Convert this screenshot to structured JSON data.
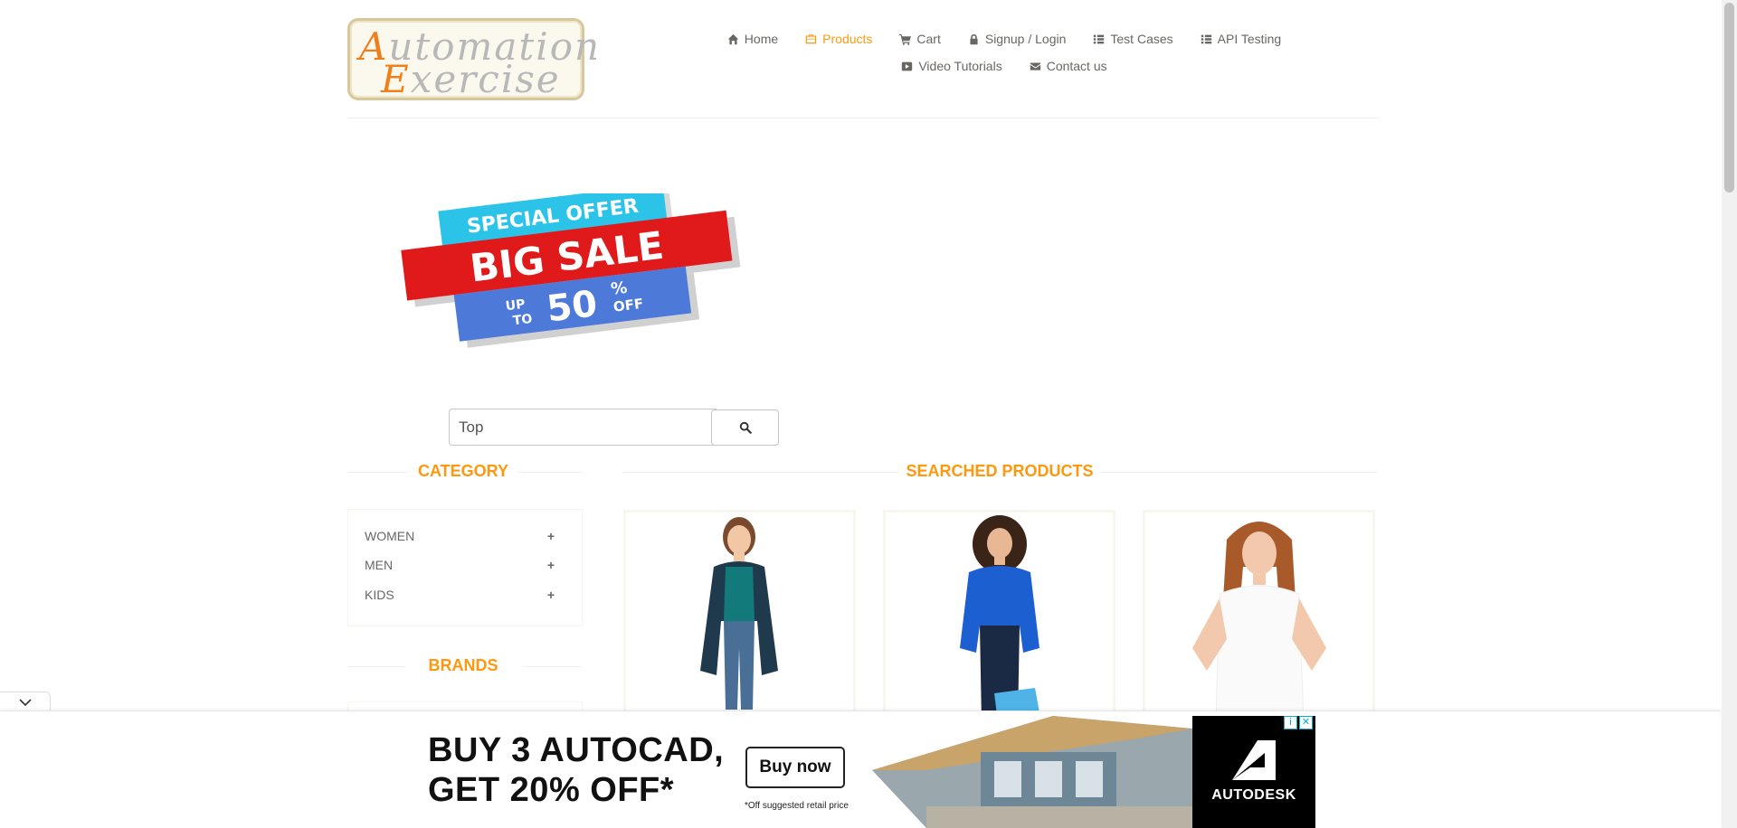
{
  "logo": {
    "line1_cap": "A",
    "line1_rest": "utomation",
    "line2_cap": "E",
    "line2_rest": "xercise"
  },
  "nav": {
    "items": [
      {
        "label": "Home",
        "icon": "home-icon"
      },
      {
        "label": "Products",
        "icon": "briefcase-icon",
        "active": true
      },
      {
        "label": "Cart",
        "icon": "cart-icon"
      },
      {
        "label": "Signup / Login",
        "icon": "lock-icon"
      },
      {
        "label": "Test Cases",
        "icon": "list-icon"
      },
      {
        "label": "API Testing",
        "icon": "list-icon"
      },
      {
        "label": "Video Tutorials",
        "icon": "youtube-icon"
      },
      {
        "label": "Contact us",
        "icon": "envelope-icon"
      }
    ]
  },
  "banner": {
    "top": "SPECIAL OFFER",
    "middle": "BIG SALE",
    "up": "UP",
    "to": "TO",
    "percent": "50",
    "pct_sign": "%",
    "off": "OFF"
  },
  "search": {
    "value": "Top",
    "icon": "search-icon"
  },
  "sidebar": {
    "category_title": "CATEGORY",
    "categories": [
      {
        "label": "WOMEN",
        "icon": "plus-icon"
      },
      {
        "label": "MEN",
        "icon": "plus-icon"
      },
      {
        "label": "KIDS",
        "icon": "plus-icon"
      }
    ],
    "brands_title": "BRANDS"
  },
  "main": {
    "title": "SEARCHED PRODUCTS"
  },
  "ad": {
    "headline_1": "BUY 3 AUTOCAD,",
    "headline_2": "GET 20% OFF*",
    "button": "Buy now",
    "fine_print": "*Off suggested retail price",
    "brand": "AUTODESK"
  },
  "colors": {
    "accent": "#fe980f",
    "text": "#696763",
    "sale_red": "#e01a1a",
    "sale_cyan": "#2cc3e8",
    "sale_blue": "#4d79d8"
  }
}
